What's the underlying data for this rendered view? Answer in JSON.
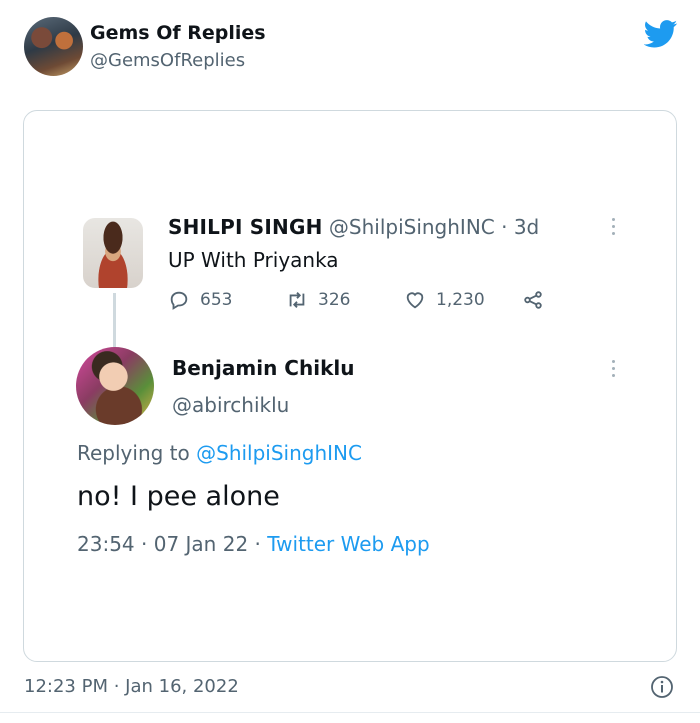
{
  "author": {
    "display_name": "Gems Of Replies",
    "handle": "@GemsOfReplies",
    "avatar_icon": "profile-photo"
  },
  "brand_icon": "twitter-bird-icon",
  "brand_color": "#1d9bf0",
  "screenshot": {
    "parent_tweet": {
      "name": "SHILPI SINGH",
      "handle": "@ShilpiSinghINC",
      "separator": "·",
      "age": "3d",
      "text": "UP With Priyanka",
      "replies": "653",
      "retweets": "326",
      "likes": "1,230"
    },
    "reply_tweet": {
      "name": "Benjamin Chiklu",
      "handle": "@abirchiklu",
      "replying_prefix": "Replying to",
      "replying_to": "@ShilpiSinghINC",
      "text": "no! I pee alone",
      "time": "23:54",
      "separator": "·",
      "date": "07 Jan 22",
      "source": "Twitter Web App"
    }
  },
  "footer": {
    "timestamp": "12:23 PM · Jan 16, 2022",
    "info_icon": "info-icon"
  },
  "colors": {
    "text_primary": "#0f1419",
    "text_secondary": "#536471",
    "link": "#1d9bf0",
    "border": "#cfd9de"
  }
}
